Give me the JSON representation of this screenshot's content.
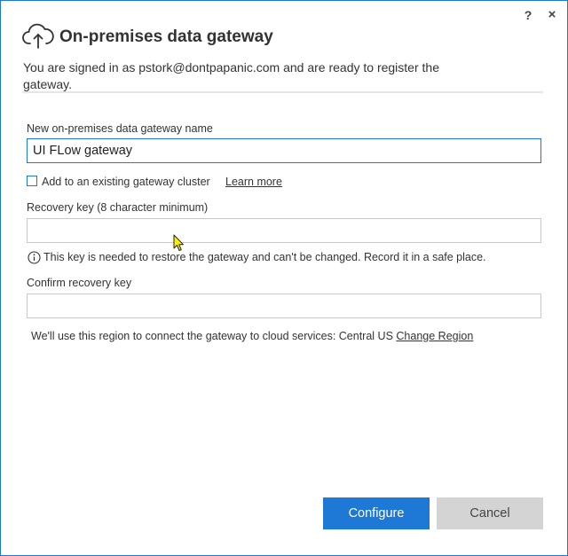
{
  "titlebar": {
    "help_label": "?",
    "close_label": "×"
  },
  "header": {
    "title": "On-premises data gateway",
    "subtitle": "You are signed in as pstork@dontpapanic.com and are ready to register the gateway."
  },
  "form": {
    "name_label": "New on-premises data gateway name",
    "name_value": "UI FLow gateway",
    "cluster_checkbox_label": "Add to an existing gateway cluster",
    "cluster_checkbox_checked": false,
    "learn_more_label": "Learn more",
    "recovery_key_label": "Recovery key (8 character minimum)",
    "recovery_key_value": "",
    "recovery_info": "This key is needed to restore the gateway and can't be changed. Record it in a safe place.",
    "confirm_key_label": "Confirm recovery key",
    "confirm_key_value": "",
    "region_text": "We'll use this region to connect the gateway to cloud services: Central US",
    "change_region_label": "Change Region"
  },
  "buttons": {
    "configure_label": "Configure",
    "cancel_label": "Cancel"
  },
  "colors": {
    "accent": "#1e78d6",
    "cancel_bg": "#d4d4d4",
    "rule": "#e6e6e6"
  }
}
